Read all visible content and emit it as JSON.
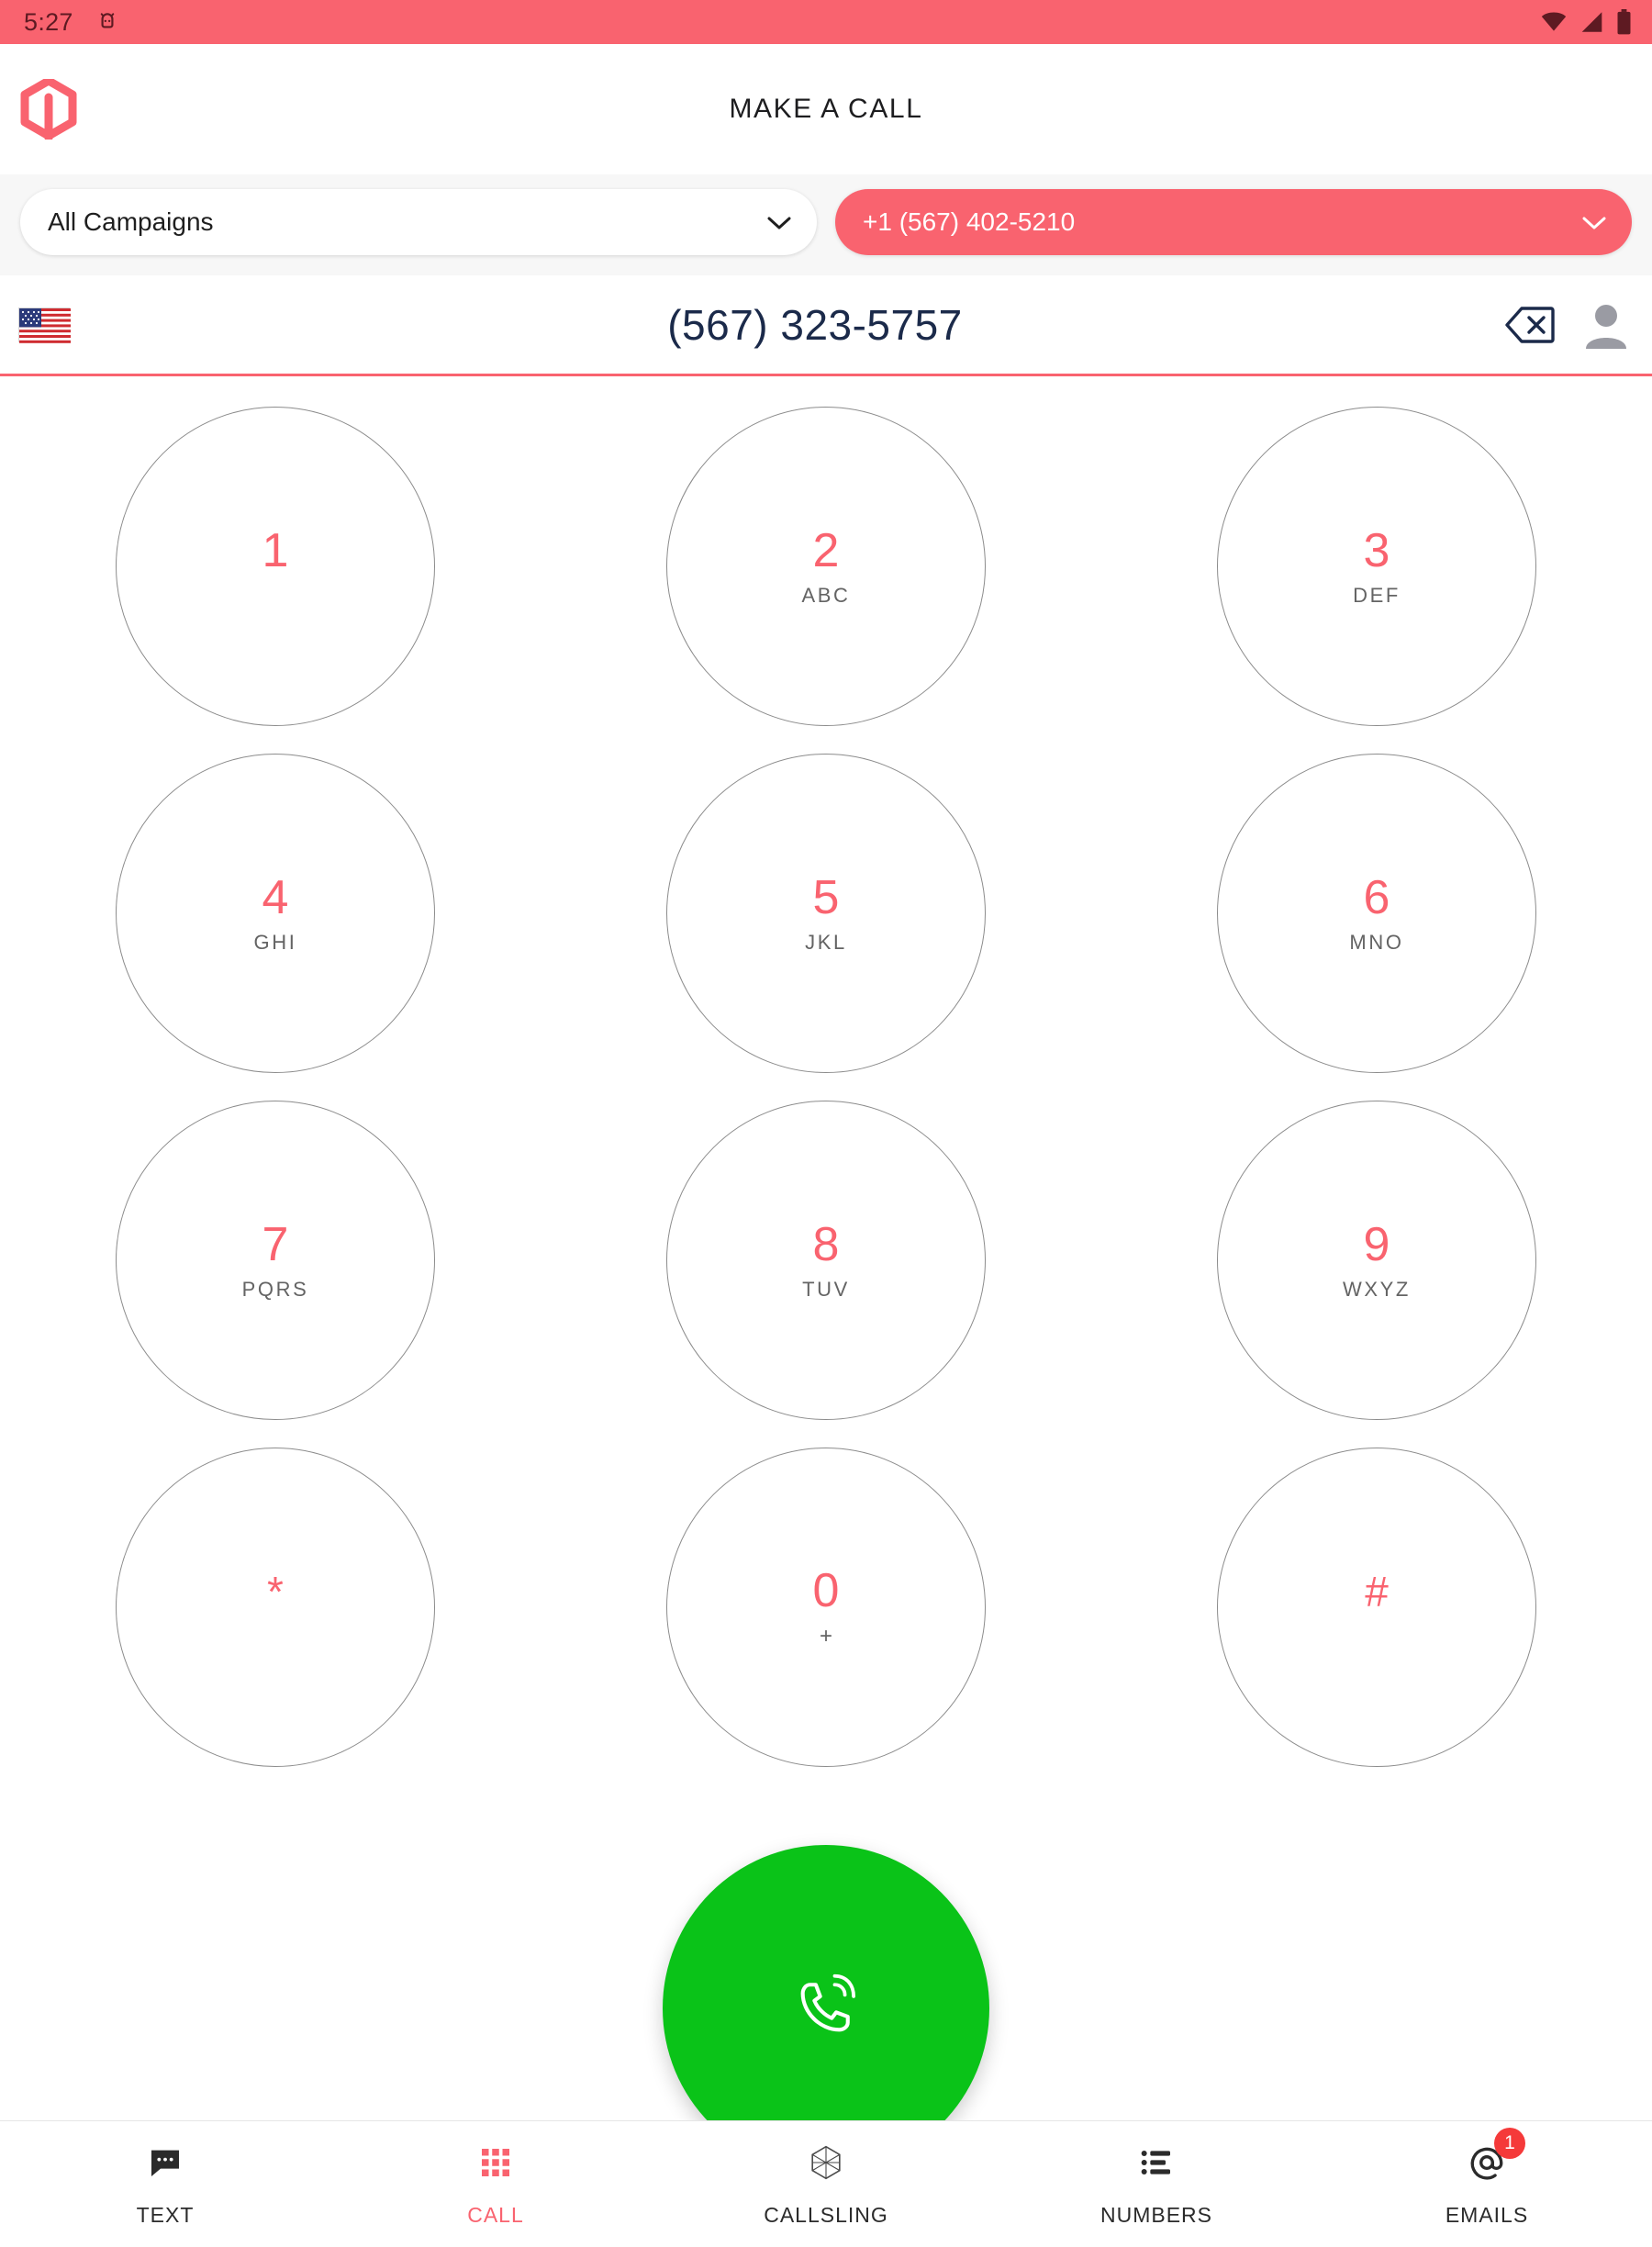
{
  "status_bar": {
    "time": "5:27",
    "notification_icon": "android-icon",
    "wifi_icon": "wifi-icon",
    "signal_icon": "cellular-signal-icon",
    "battery_icon": "battery-icon",
    "background_color": "#f9636f"
  },
  "header": {
    "title": "MAKE A CALL",
    "logo_icon": "app-logo-hexagon-icon",
    "logo_color": "#f9636f"
  },
  "selectors": {
    "campaign": {
      "value": "All Campaigns",
      "chevron_icon": "chevron-down-icon"
    },
    "phone_line": {
      "value": "+1 (567) 402-5210",
      "chevron_icon": "chevron-down-icon",
      "background_color": "#f9636f"
    }
  },
  "number_input": {
    "country_flag_icon": "us-flag-icon",
    "dialed_number": "(567) 323-5757",
    "backspace_icon": "backspace-delete-icon",
    "contact_icon": "contact-person-icon",
    "underline_color": "#f9636f"
  },
  "keypad": {
    "digit_color": "#f9636f",
    "keys": [
      {
        "digit": "1",
        "letters": ""
      },
      {
        "digit": "2",
        "letters": "ABC"
      },
      {
        "digit": "3",
        "letters": "DEF"
      },
      {
        "digit": "4",
        "letters": "GHI"
      },
      {
        "digit": "5",
        "letters": "JKL"
      },
      {
        "digit": "6",
        "letters": "MNO"
      },
      {
        "digit": "7",
        "letters": "PQRS"
      },
      {
        "digit": "8",
        "letters": "TUV"
      },
      {
        "digit": "9",
        "letters": "WXYZ"
      },
      {
        "digit": "*",
        "letters": ""
      },
      {
        "digit": "0",
        "letters": "+"
      },
      {
        "digit": "#",
        "letters": ""
      }
    ]
  },
  "call_button": {
    "icon": "phone-call-icon",
    "color": "#0ac318"
  },
  "bottom_nav": {
    "items": [
      {
        "label": "TEXT",
        "icon": "message-bubble-icon",
        "active": false,
        "badge": ""
      },
      {
        "label": "CALL",
        "icon": "dialpad-grid-icon",
        "active": true,
        "badge": ""
      },
      {
        "label": "CALLSLING",
        "icon": "hexagon-mesh-icon",
        "active": false,
        "badge": ""
      },
      {
        "label": "NUMBERS",
        "icon": "list-icon",
        "active": false,
        "badge": ""
      },
      {
        "label": "EMAILS",
        "icon": "at-sign-icon",
        "active": false,
        "badge": "1"
      }
    ],
    "active_color": "#f9636f",
    "badge_color": "#f53a3a"
  }
}
